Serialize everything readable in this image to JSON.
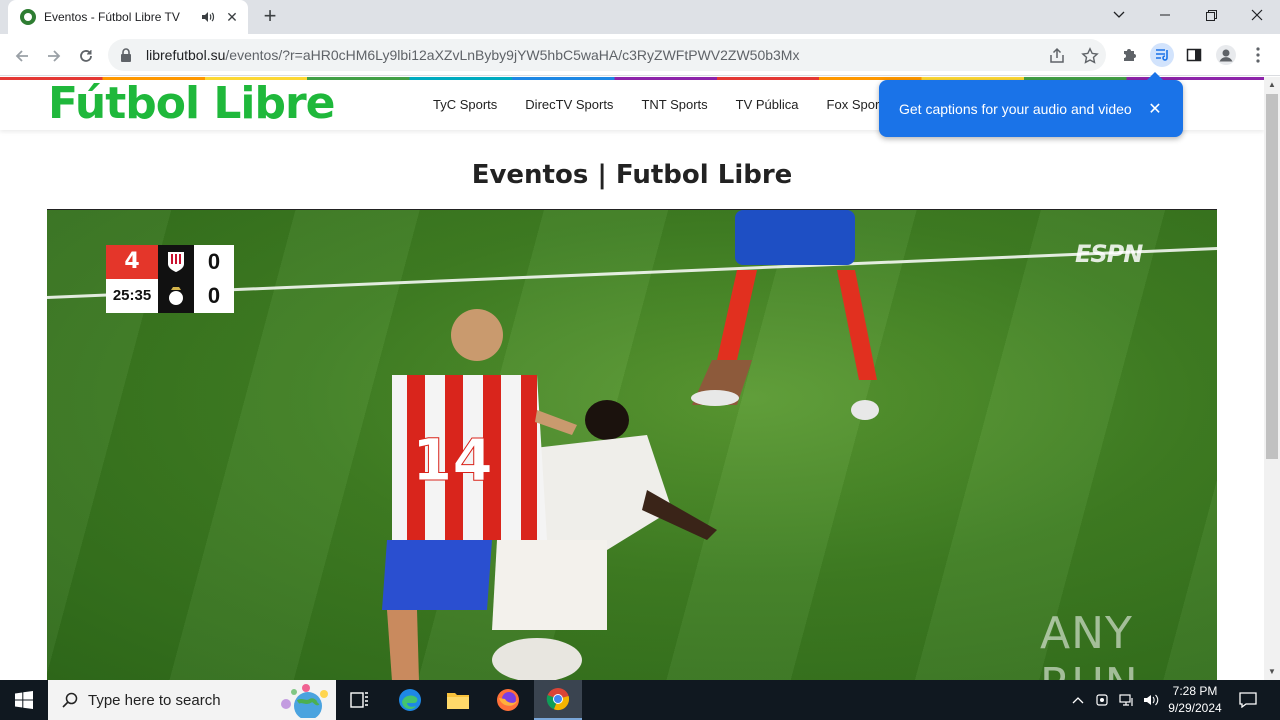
{
  "browser": {
    "tab_title": "Eventos - Fútbol Libre TV",
    "url_host": "librefutbol.su",
    "url_path": "/eventos/?r=aHR0cHM6Ly9lbi12aXZvLnByby9jYW5hbC5waHA/c3RyZWFtPWV2ZW50b3Mx",
    "window_controls": [
      "chevron-down-icon",
      "minimize-icon",
      "restore-icon",
      "close-icon"
    ]
  },
  "caption_popup": {
    "text": "Get captions for your audio and video"
  },
  "site": {
    "logo": "Fútbol Libre",
    "nav": [
      "TyC Sports",
      "DirecTV Sports",
      "TNT Sports",
      "TV Pública",
      "Fox Spor"
    ],
    "page_title": "Eventos | Futbol Libre"
  },
  "video": {
    "league_glyph": "4",
    "clock": "25:35",
    "home_score": "0",
    "away_score": "0",
    "broadcaster": "ESPN",
    "watermark": "ANY RUN"
  },
  "taskbar": {
    "search_placeholder": "Type here to search",
    "time": "7:28 PM",
    "date": "9/29/2024"
  },
  "colors": {
    "brand_green": "#1fb83b",
    "popup_blue": "#1a73e8",
    "taskbar": "#101820"
  }
}
